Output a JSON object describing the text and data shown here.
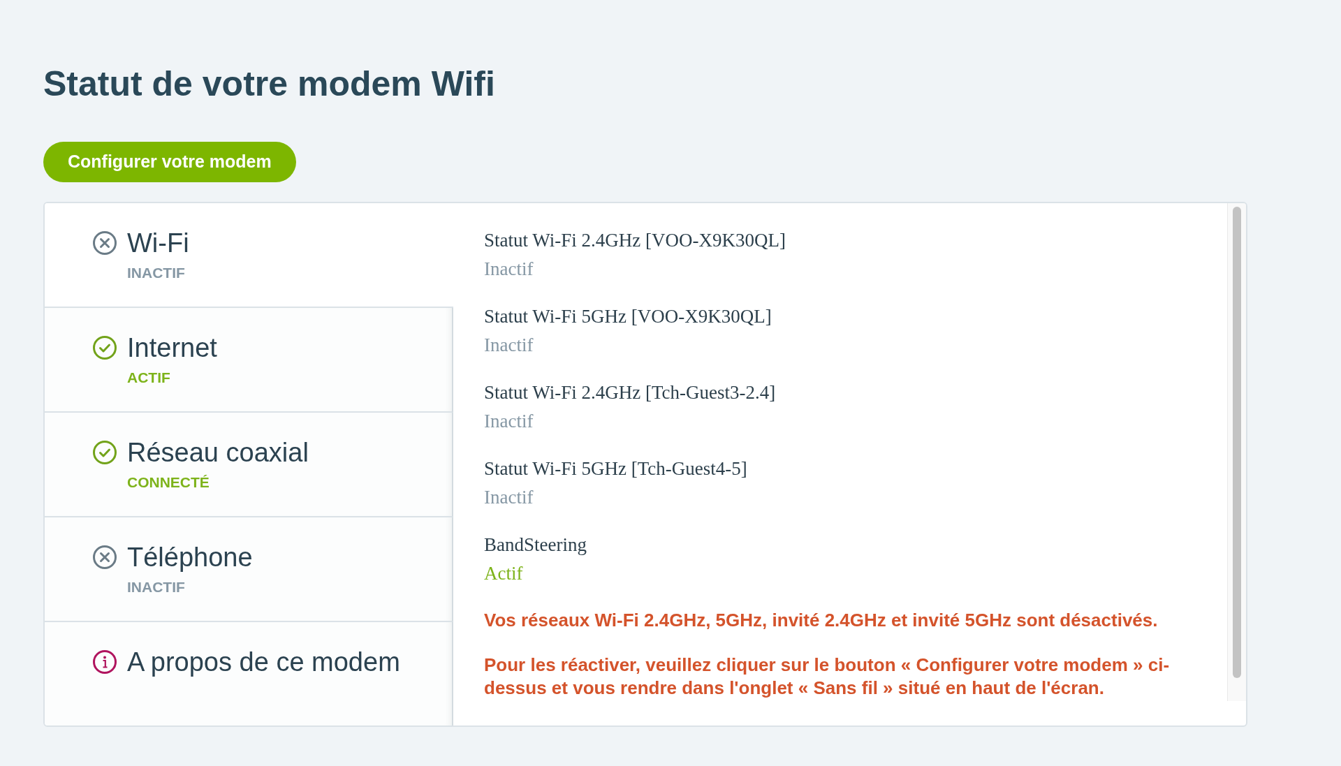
{
  "title": "Statut de votre modem Wifi",
  "configure_button": {
    "label": "Configurer votre modem"
  },
  "sections": [
    {
      "label": "Wi-Fi",
      "status": "INACTIF",
      "kind": "inactive",
      "selected": true
    },
    {
      "label": "Internet",
      "status": "ACTIF",
      "kind": "active",
      "selected": false
    },
    {
      "label": "Réseau coaxial",
      "status": "CONNECTÉ",
      "kind": "active",
      "selected": false
    },
    {
      "label": "Téléphone",
      "status": "INACTIF",
      "kind": "inactive",
      "selected": false
    },
    {
      "label": "A propos de ce modem",
      "kind": "info",
      "selected": false
    }
  ],
  "details": [
    {
      "label": "Statut Wi-Fi 2.4GHz [VOO-X9K30QL]",
      "value": "Inactif",
      "active": false
    },
    {
      "label": "Statut Wi-Fi 5GHz [VOO-X9K30QL]",
      "value": "Inactif",
      "active": false
    },
    {
      "label": "Statut Wi-Fi 2.4GHz [Tch-Guest3-2.4]",
      "value": "Inactif",
      "active": false
    },
    {
      "label": "Statut Wi-Fi 5GHz [Tch-Guest4-5]",
      "value": "Inactif",
      "active": false
    },
    {
      "label": "BandSteering",
      "value": "Actif",
      "active": true
    }
  ],
  "notices": [
    "Vos réseaux Wi-Fi 2.4GHz, 5GHz, invité 2.4GHz et invité 5GHz sont désactivés.",
    "Pour les réactiver, veuillez cliquer sur le bouton « Configurer votre modem » ci-dessus et vous rendre dans l'onglet « Sans fil » situé en haut de l'écran."
  ]
}
